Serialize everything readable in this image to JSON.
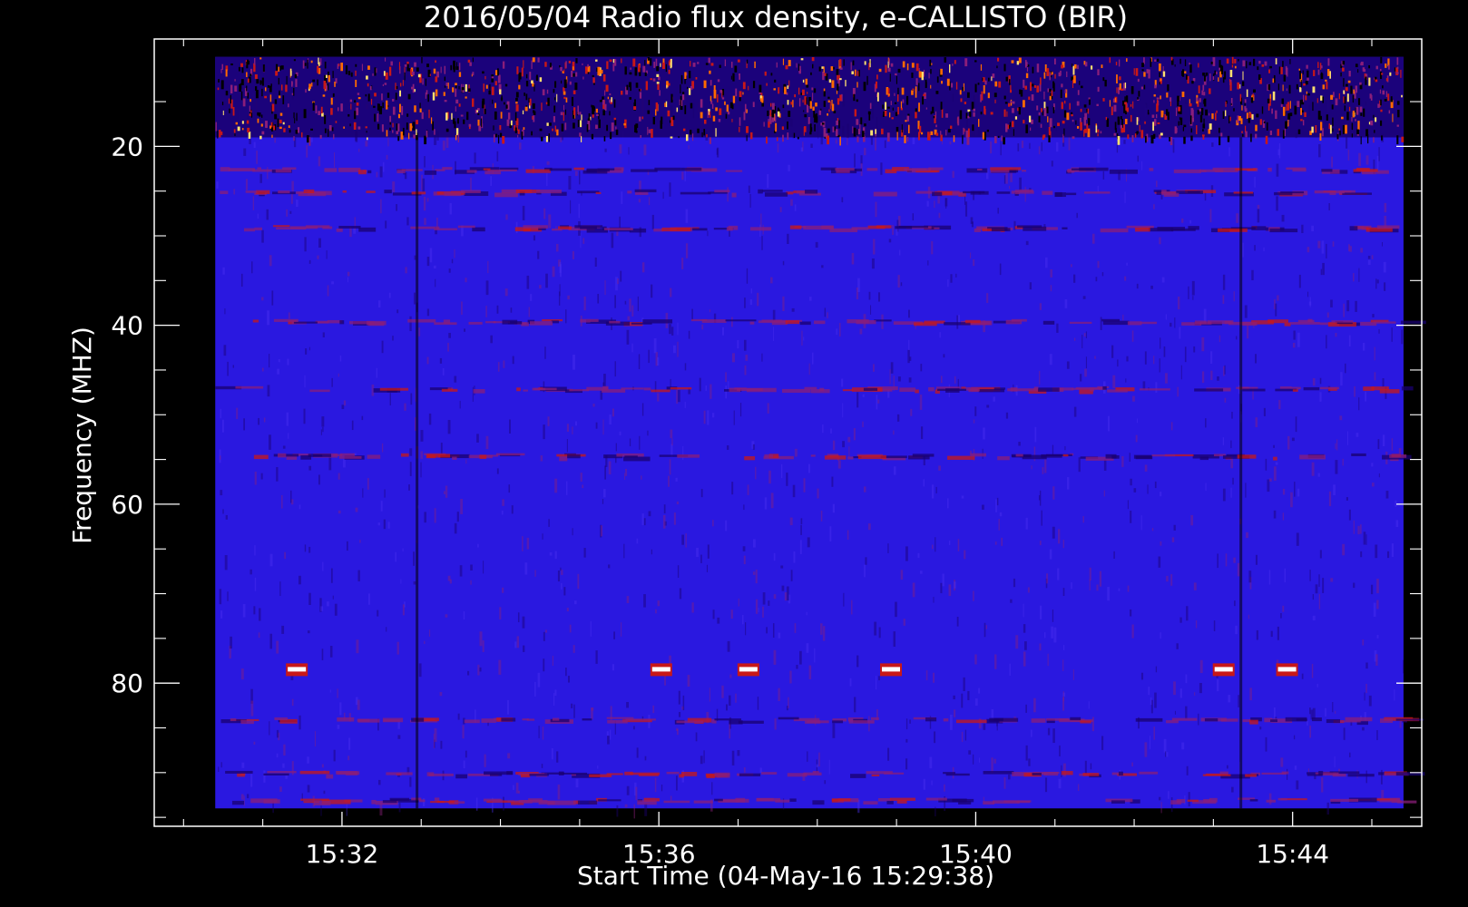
{
  "chart_data": {
    "type": "heatmap",
    "title": "2016/05/04  Radio flux density, e-CALLISTO (BIR)",
    "xlabel": "Start Time (04-May-16 15:29:38)",
    "ylabel": "Frequency (MHZ)",
    "x_ticks": [
      "15:32",
      "15:36",
      "15:40",
      "15:44"
    ],
    "x_tick_minutes": [
      2.37,
      6.37,
      10.37,
      14.37
    ],
    "y_ticks": [
      "20",
      "40",
      "60",
      "80"
    ],
    "y_tick_values": [
      20,
      40,
      60,
      80
    ],
    "xlim_minutes": [
      0,
      16.0
    ],
    "ylim_mhz": [
      96,
      8
    ],
    "data_extent": {
      "t_start_min": 0.77,
      "t_end_min": 15.77,
      "f_top_mhz": 10,
      "f_bottom_mhz": 94
    },
    "colormap": [
      "#000000",
      "#1a0070",
      "#3310d8",
      "#8a1e7a",
      "#c81818",
      "#ff6a00",
      "#ffe070",
      "#ffffff"
    ],
    "background_color": "#2a18e0",
    "features": {
      "top_band_mhz": [
        10,
        19
      ],
      "bursts_at_mhz": 78.5,
      "burst_times_min": [
        1.8,
        6.4,
        7.5,
        9.3,
        13.5,
        14.3
      ],
      "vertical_dropouts_min": [
        3.3,
        13.7
      ],
      "horizontal_bands_mhz": [
        22.5,
        25,
        29,
        39.5,
        47,
        54.5,
        84,
        90,
        93
      ]
    }
  }
}
